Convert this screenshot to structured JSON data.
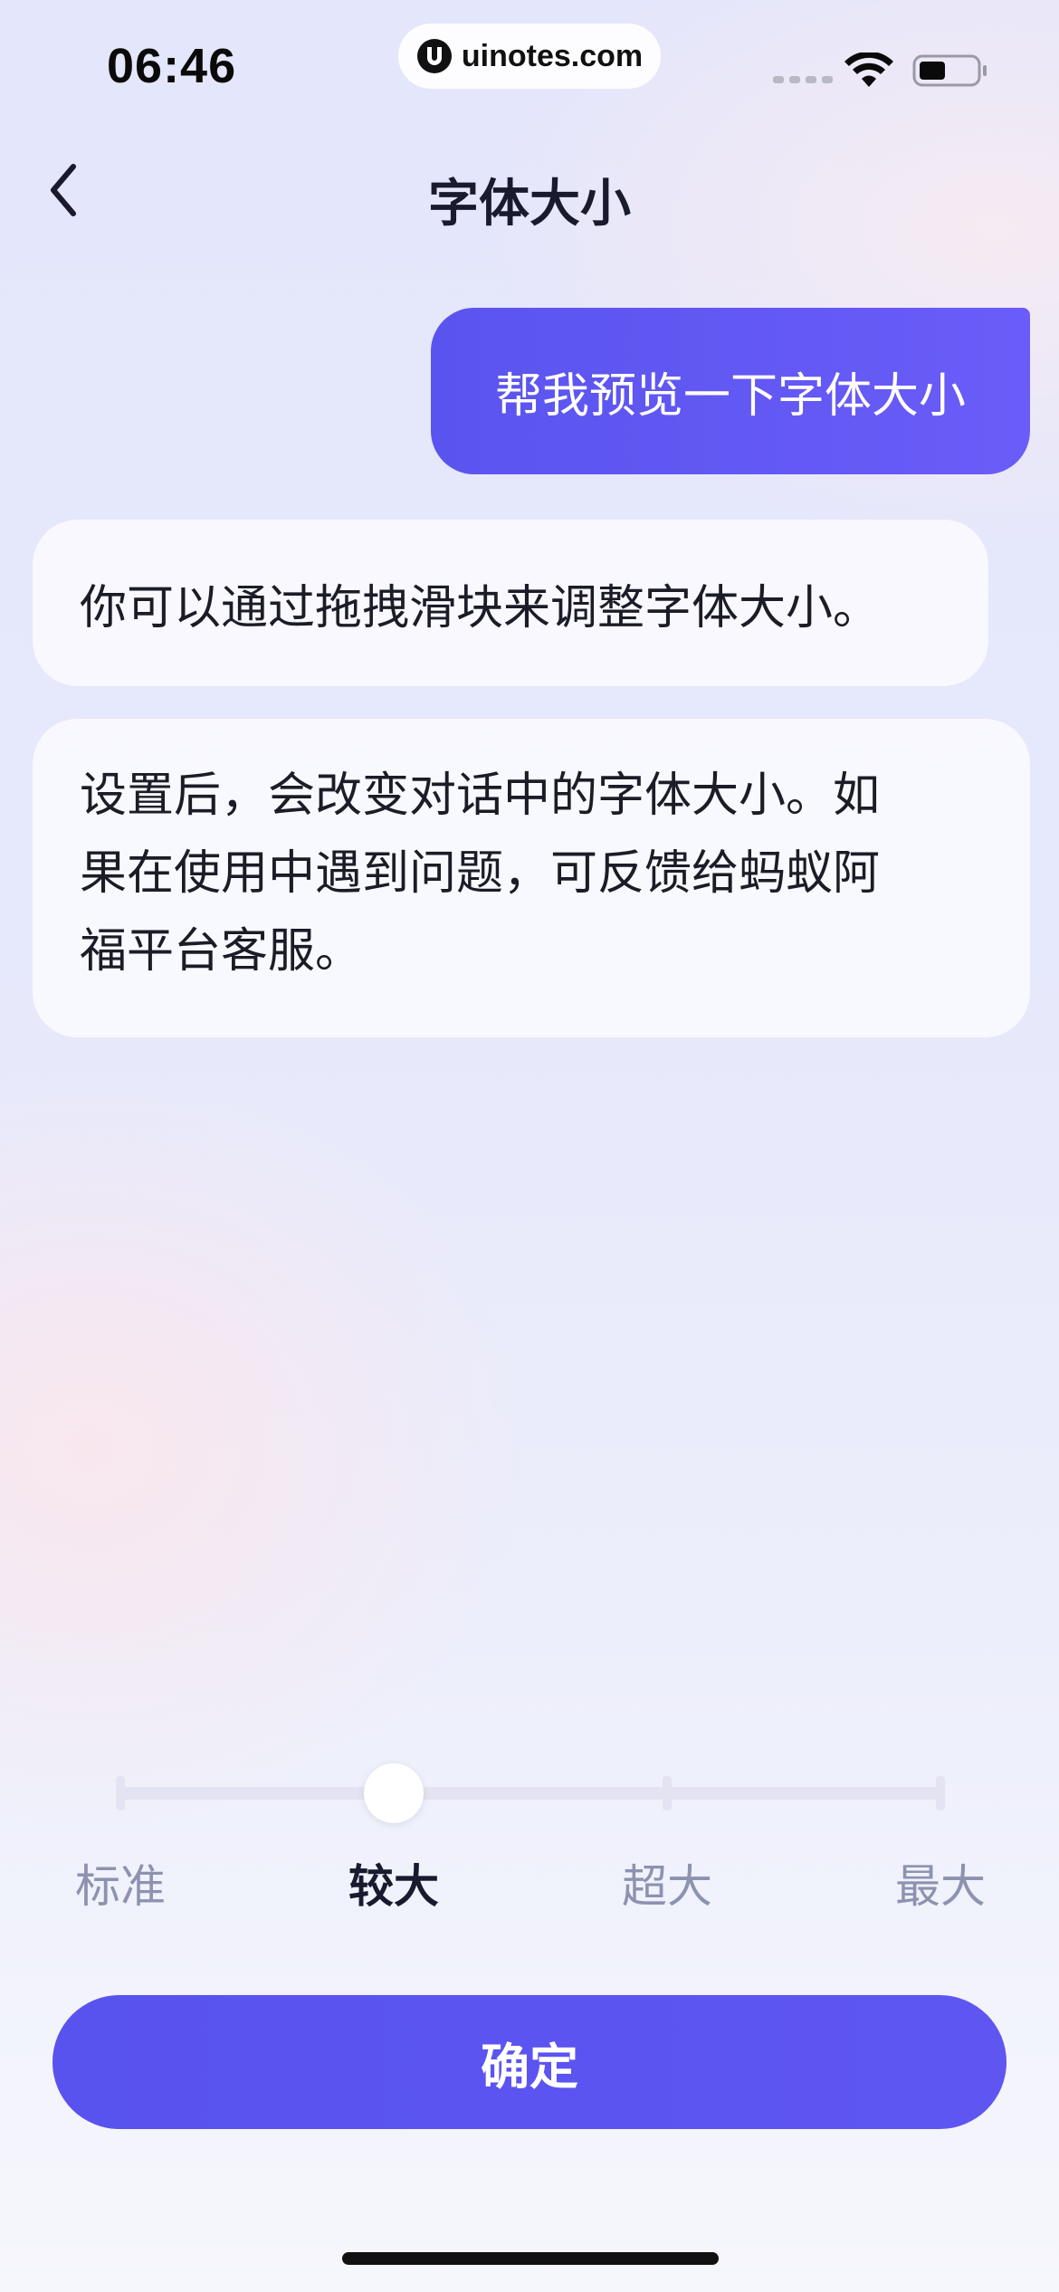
{
  "status_bar": {
    "time": "06:46",
    "watermark": "uinotes.com"
  },
  "header": {
    "title": "字体大小"
  },
  "chat": {
    "user_message": "帮我预览一下字体大小",
    "bot_message_1": "你可以通过拖拽滑块来调整字体大小。",
    "bot_message_2_lines": [
      "设置后，会改变对话中的字体大小。如",
      "果在使用中遇到问题，可反馈给蚂蚁阿",
      "福平台客服。"
    ]
  },
  "font_size_slider": {
    "options": [
      "标准",
      "较大",
      "超大",
      "最大"
    ],
    "selected_index": 1,
    "selected": "较大"
  },
  "footer": {
    "confirm_label": "确定"
  },
  "colors": {
    "accent": "#5a54ee",
    "selected_text": "#1a1a2e",
    "unselected_text": "#8d92b0"
  }
}
